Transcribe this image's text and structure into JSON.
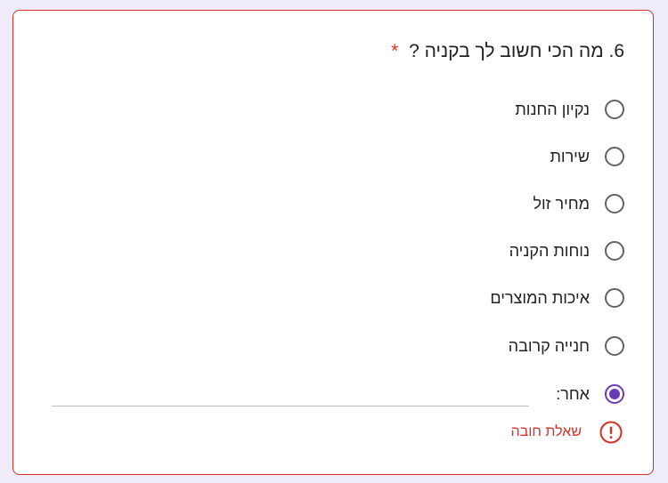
{
  "question": {
    "title": "6. מה הכי חשוב לך בקניה ?",
    "required_marker": "*"
  },
  "options": [
    {
      "label": "נקיון החנות",
      "selected": false
    },
    {
      "label": "שירות",
      "selected": false
    },
    {
      "label": "מחיר זול",
      "selected": false
    },
    {
      "label": "נוחות הקניה",
      "selected": false
    },
    {
      "label": "איכות המוצרים",
      "selected": false
    },
    {
      "label": "חנייה קרובה",
      "selected": false
    },
    {
      "label": "אחר:",
      "selected": true
    }
  ],
  "other_input": {
    "value": ""
  },
  "error": {
    "message": "שאלת חובה",
    "icon": "error-icon"
  },
  "colors": {
    "accent": "#673ab7",
    "error": "#d93025",
    "background": "#efebf8"
  }
}
